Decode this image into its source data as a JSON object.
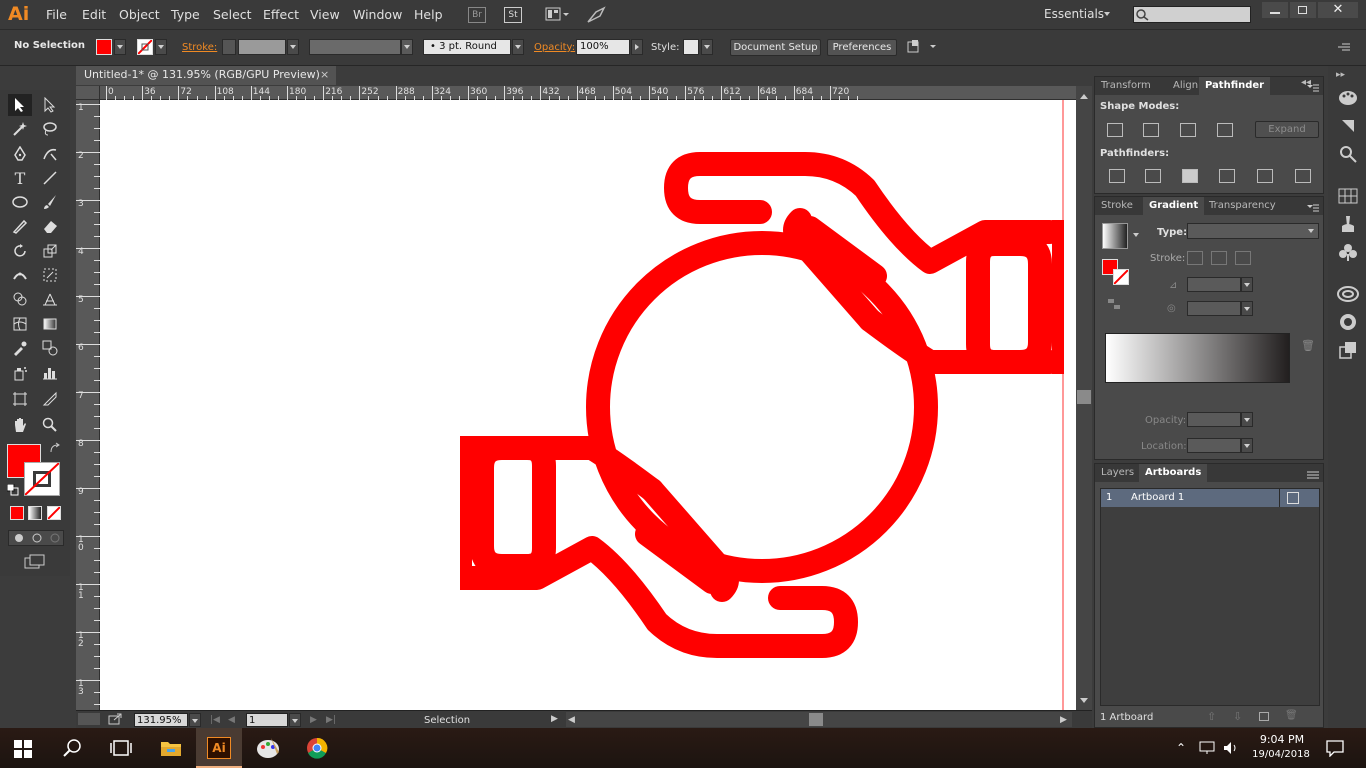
{
  "app": {
    "logo": "Ai"
  },
  "menu": [
    "File",
    "Edit",
    "Object",
    "Type",
    "Select",
    "Effect",
    "View",
    "Window",
    "Help"
  ],
  "menu_icons": [
    "Br",
    "St"
  ],
  "workspace": "Essentials",
  "control": {
    "selection": "No Selection",
    "stroke_label": "Stroke:",
    "brush": "3 pt. Round",
    "opacity_label": "Opacity:",
    "opacity_value": "100%",
    "style_label": "Style:",
    "document_setup": "Document Setup",
    "preferences": "Preferences"
  },
  "document": {
    "tab": "Untitled-1* @ 131.95% (RGB/GPU Preview)",
    "close": "×"
  },
  "ruler_h": [
    "0",
    "36",
    "72",
    "108",
    "144",
    "180",
    "216",
    "252",
    "288",
    "324",
    "360",
    "396",
    "432",
    "468",
    "504",
    "540",
    "576",
    "612",
    "648",
    "684",
    "720"
  ],
  "ruler_v": [
    "1\n8",
    "2",
    "3\n6",
    "4\n3",
    "5\n0",
    "5\n7",
    "6\n4",
    "7\n1",
    "7\n8",
    "8\n5",
    "9\n2",
    "1\n9\n9",
    "2\n0\n6"
  ],
  "ruler_v_simple": [
    "1",
    "2",
    "3",
    "4",
    "5",
    "6",
    "7",
    "8",
    "9",
    "10",
    "11",
    "12",
    "13"
  ],
  "status": {
    "zoom": "131.95%",
    "artboard_no": "1",
    "tool": "Selection"
  },
  "colors": {
    "fill": "#ff0000",
    "accent": "#f08a24",
    "artwork": "#ff0000"
  },
  "pathfinder": {
    "tabs": [
      "Transform",
      "Align",
      "Pathfinder"
    ],
    "shape_modes": "Shape Modes:",
    "expand": "Expand",
    "pathfinders": "Pathfinders:"
  },
  "gradient": {
    "tabs": [
      "Stroke",
      "Gradient",
      "Transparency"
    ],
    "type_label": "Type:",
    "stroke_label": "Stroke:",
    "opacity_label": "Opacity:",
    "location_label": "Location:"
  },
  "artboards": {
    "tabs": [
      "Layers",
      "Artboards"
    ],
    "rows": [
      {
        "num": "1",
        "name": "Artboard 1"
      }
    ],
    "footer": "1 Artboard"
  },
  "taskbar": {
    "time": "9:04 PM",
    "date": "19/04/2018",
    "apps": [
      "file-explorer",
      "illustrator",
      "paint",
      "chrome"
    ],
    "ai_label": "Ai"
  }
}
